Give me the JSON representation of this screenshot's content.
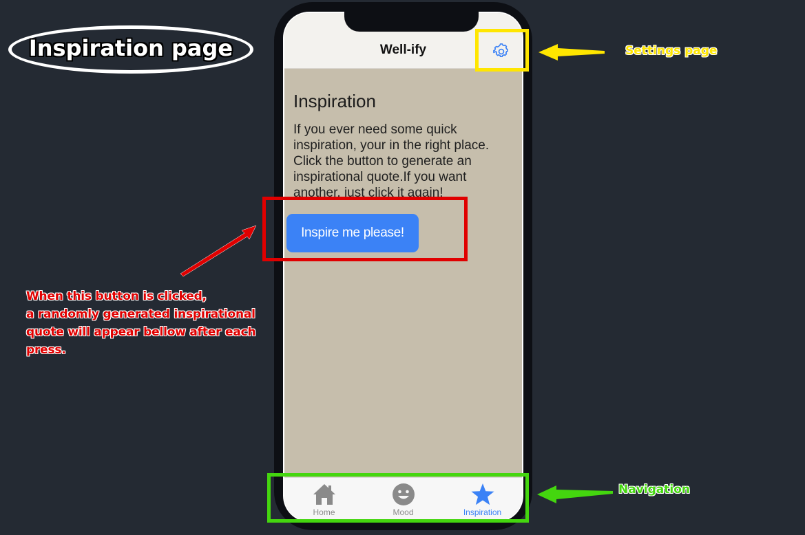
{
  "slide": {
    "title": "Inspiration page"
  },
  "app": {
    "title": "Well-ify",
    "settings_icon": "gear-icon"
  },
  "content": {
    "heading": "Inspiration",
    "paragraph": "If you ever need some quick inspiration, your in the right place. Click the button to generate an inspirational quote.If you want another, just click it again!",
    "button_label": "Inspire me please!"
  },
  "tabs": [
    {
      "label": "Home",
      "icon": "home-icon",
      "active": false
    },
    {
      "label": "Mood",
      "icon": "smiley-icon",
      "active": false
    },
    {
      "label": "Inspiration",
      "icon": "star-icon",
      "active": true
    }
  ],
  "annotations": {
    "settings": "Settings page",
    "navigation": "Navigation",
    "button_note_1": "When this button is clicked,",
    "button_note_2": "a randomly generated inspirational",
    "button_note_3": "quote will appear bellow after each",
    "button_note_4": "press.",
    "colors": {
      "yellow": "#ffe600",
      "red": "#e00000",
      "green": "#44d60f",
      "accent_blue": "#3b82f6"
    }
  }
}
